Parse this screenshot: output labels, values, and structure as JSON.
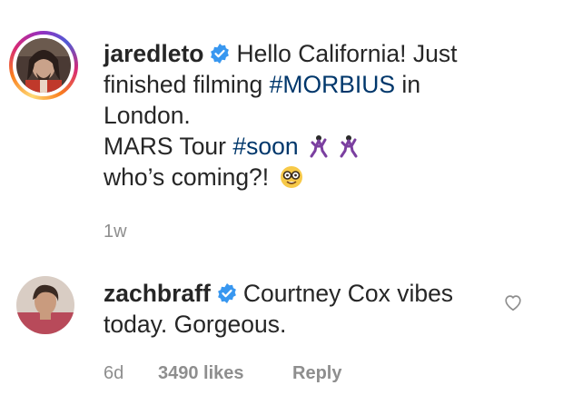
{
  "comment1": {
    "username": "jaredleto",
    "verified_icon": "verified-badge-icon",
    "lines": {
      "line1_text": "Hello California! Just",
      "line2_prefix": "finished filming ",
      "line2_hashtag": "#MORBIUS",
      "line2_suffix": " in",
      "line3_text": "London.",
      "line4_prefix": "MARS Tour ",
      "line4_hashtag": "#soon",
      "line5_text": "who’s coming?!"
    },
    "emojis": [
      "dancing-man-icon",
      "dancing-man-icon",
      "nerd-face-icon"
    ],
    "time": "1w"
  },
  "comment2": {
    "username": "zachbraff",
    "verified_icon": "verified-badge-icon",
    "text_line1": "Courtney Cox vibes",
    "text_line2": "today. Gorgeous.",
    "time": "6d",
    "likes": "3490 likes",
    "reply_label": "Reply",
    "like_icon": "heart-outline-icon"
  },
  "colors": {
    "text": "#262626",
    "secondary": "#8e8e8e",
    "hashtag": "#00376b",
    "verified": "#3897f0"
  }
}
